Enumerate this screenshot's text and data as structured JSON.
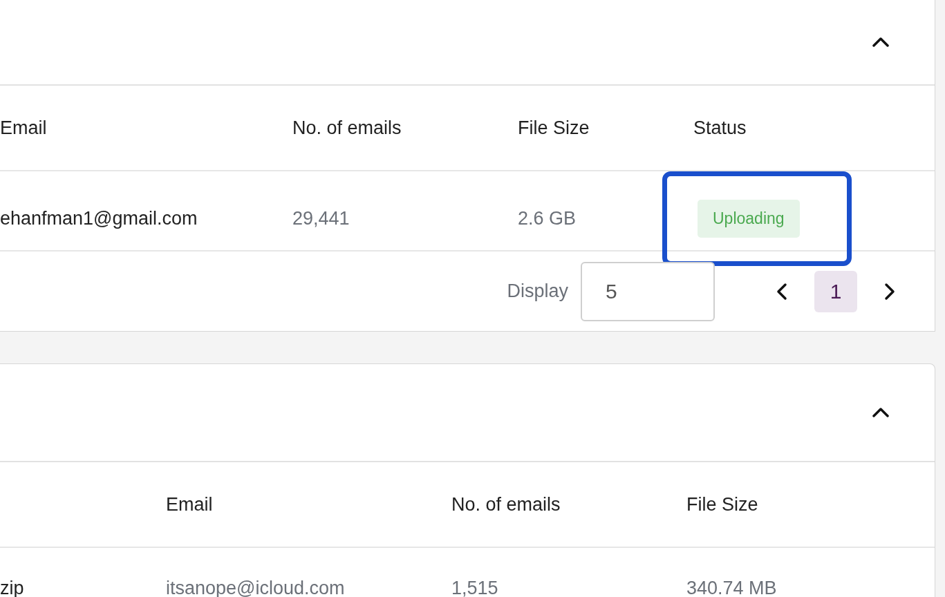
{
  "uploads": {
    "columns": [
      "Email",
      "No. of emails",
      "File Size",
      "Status"
    ],
    "rows": [
      {
        "email": "ehanfman1@gmail.com",
        "count": "29,441",
        "size": "2.6 GB",
        "status": "Uploading",
        "highlighted": true
      }
    ],
    "display_label": "Display",
    "display_value": "5",
    "pages": [
      {
        "label": "1",
        "selected": true
      }
    ]
  },
  "archives": {
    "columns": [
      "Email",
      "No. of emails",
      "File Size"
    ],
    "rows": [
      {
        "file": "zip",
        "email": "itsanope@icloud.com",
        "count": "1,515",
        "size": "340.74 MB"
      }
    ]
  }
}
